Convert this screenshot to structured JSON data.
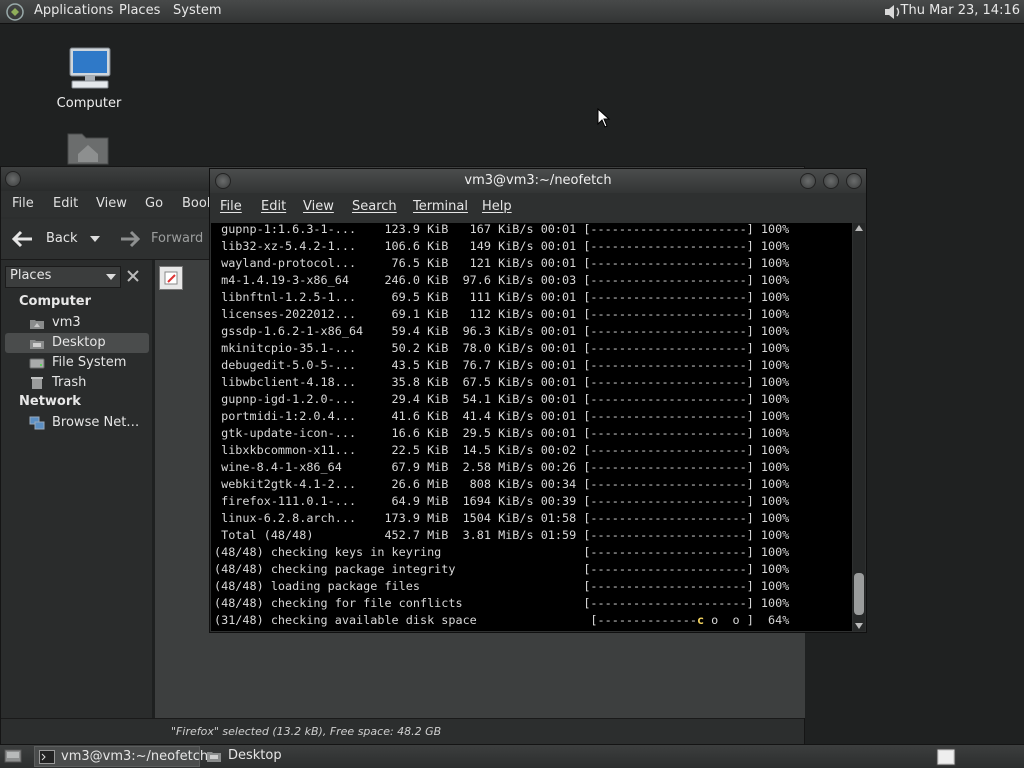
{
  "top_panel": {
    "menus": [
      "Applications",
      "Places",
      "System"
    ],
    "clock": "Thu Mar 23, 14:16",
    "icons": {
      "logo": "distro-logo-icon",
      "volume": "volume-icon"
    }
  },
  "desktop": {
    "icons": [
      {
        "label": "Computer",
        "icon": "computer-icon"
      },
      {
        "label": "",
        "icon": "home-folder-icon"
      }
    ]
  },
  "file_manager": {
    "menus": [
      "File",
      "Edit",
      "View",
      "Go",
      "Book"
    ],
    "toolbar": {
      "back": "Back",
      "forward": "Forward"
    },
    "sidebar_selector": "Places",
    "sidebar": {
      "computer_heading": "Computer",
      "computer_items": [
        {
          "label": "vm3",
          "icon": "home-icon",
          "selected": false
        },
        {
          "label": "Desktop",
          "icon": "desktop-icon",
          "selected": true
        },
        {
          "label": "File System",
          "icon": "drive-icon",
          "selected": false
        },
        {
          "label": "Trash",
          "icon": "trash-icon",
          "selected": false
        }
      ],
      "network_heading": "Network",
      "network_items": [
        {
          "label": "Browse Net…",
          "icon": "network-icon"
        }
      ]
    },
    "status": "\"Firefox\" selected (13.2 kB), Free space: 48.2 GB"
  },
  "terminal": {
    "title": "vm3@vm3:~/neofetch",
    "menus": [
      "File",
      "Edit",
      "View",
      "Search",
      "Terminal",
      "Help"
    ],
    "lines": [
      " gupnp-1:1.6.3-1-...    123.9 KiB   167 KiB/s 00:01 [----------------------] 100%",
      " lib32-xz-5.4.2-1...    106.6 KiB   149 KiB/s 00:01 [----------------------] 100%",
      " wayland-protocol...     76.5 KiB   121 KiB/s 00:01 [----------------------] 100%",
      " m4-1.4.19-3-x86_64     246.0 KiB  97.6 KiB/s 00:03 [----------------------] 100%",
      " libnftnl-1.2.5-1...     69.5 KiB   111 KiB/s 00:01 [----------------------] 100%",
      " licenses-2022012...     69.1 KiB   112 KiB/s 00:01 [----------------------] 100%",
      " gssdp-1.6.2-1-x86_64    59.4 KiB  96.3 KiB/s 00:01 [----------------------] 100%",
      " mkinitcpio-35.1-...     50.2 KiB  78.0 KiB/s 00:01 [----------------------] 100%",
      " debugedit-5.0-5-...     43.5 KiB  76.7 KiB/s 00:01 [----------------------] 100%",
      " libwbclient-4.18...     35.8 KiB  67.5 KiB/s 00:01 [----------------------] 100%",
      " gupnp-igd-1.2.0-...     29.4 KiB  54.1 KiB/s 00:01 [----------------------] 100%",
      " portmidi-1:2.0.4...     41.6 KiB  41.4 KiB/s 00:01 [----------------------] 100%",
      " gtk-update-icon-...     16.6 KiB  29.5 KiB/s 00:01 [----------------------] 100%",
      " libxkbcommon-x11...     22.5 KiB  14.5 KiB/s 00:02 [----------------------] 100%",
      " wine-8.4-1-x86_64       67.9 MiB  2.58 MiB/s 00:26 [----------------------] 100%",
      " webkit2gtk-4.1-2...     26.6 MiB   808 KiB/s 00:34 [----------------------] 100%",
      " firefox-111.0.1-...     64.9 MiB  1694 KiB/s 00:39 [----------------------] 100%",
      " linux-6.2.8.arch...    173.9 MiB  1504 KiB/s 01:58 [----------------------] 100%",
      " Total (48/48)          452.7 MiB  3.81 MiB/s 01:59 [----------------------] 100%",
      "(48/48) checking keys in keyring                    [----------------------] 100%",
      "(48/48) checking package integrity                  [----------------------] 100%",
      "(48/48) loading package files                       [----------------------] 100%",
      "(48/48) checking for file conflicts                 [----------------------] 100%"
    ],
    "progress_line": {
      "prefix": "(31/48) checking available disk space                [--------------",
      "pacman": "c",
      "dots": " o  o ",
      "suffix": "]  64%"
    },
    "progress_percent": 64
  },
  "bottom_panel": {
    "tasks": [
      {
        "label": "vm3@vm3:~/neofetch",
        "icon": "terminal-icon",
        "active": true
      },
      {
        "label": "Desktop",
        "icon": "file-manager-icon",
        "active": false
      }
    ]
  },
  "colors": {
    "panel_bg": "#3a3c3c",
    "desktop_bg": "#1f2121",
    "terminal_bg": "#000000",
    "terminal_fg": "#d8d8d8",
    "pacman": "#f4d35e"
  }
}
